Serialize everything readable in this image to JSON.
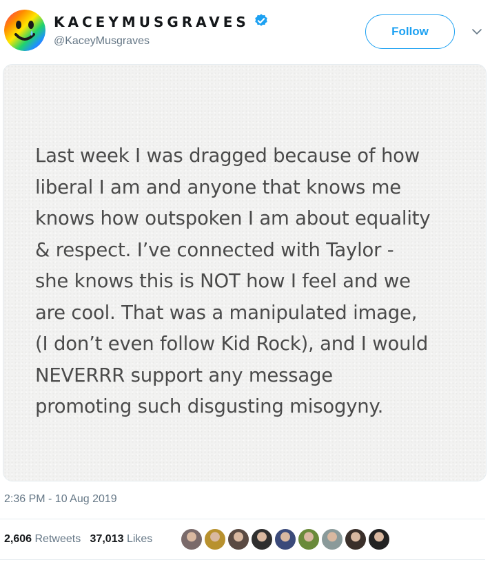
{
  "author": {
    "display_name": "KACEYMUSGRAVES",
    "handle": "@KaceyMusgraves",
    "avatar_icon": "smiley-face-rainbow-avatar",
    "verified_icon": "verified-badge-icon"
  },
  "actions": {
    "follow_label": "Follow",
    "menu_icon": "chevron-down-icon"
  },
  "media": {
    "note_lines": [
      "Last week I was dragged because of how",
      "liberal I am and anyone that knows me",
      "knows how outspoken I am about equality",
      "& respect. I’ve connected with Taylor -",
      "she knows this is NOT how I feel and we",
      "are cool. That was a manipulated image,",
      "(I don’t even follow Kid Rock), and I would",
      "NEVERRR support any message",
      "promoting such disgusting misogyny."
    ]
  },
  "tweet": {
    "timestamp": "2:36 PM - 10 Aug 2019"
  },
  "stats": {
    "retweets_count": "2,606",
    "retweets_label": "Retweets",
    "likes_count": "37,013",
    "likes_label": "Likes"
  },
  "likers": [
    {
      "name": "liker-avatar-1",
      "color": "#7a6a6a"
    },
    {
      "name": "liker-avatar-2",
      "color": "#b8912e"
    },
    {
      "name": "liker-avatar-3",
      "color": "#5a4a42"
    },
    {
      "name": "liker-avatar-4",
      "color": "#2f2f2f"
    },
    {
      "name": "liker-avatar-5",
      "color": "#3b4a7a"
    },
    {
      "name": "liker-avatar-6",
      "color": "#6a8a3a"
    },
    {
      "name": "liker-avatar-7",
      "color": "#8a9a9a"
    },
    {
      "name": "liker-avatar-8",
      "color": "#3a2f2a"
    },
    {
      "name": "liker-avatar-9",
      "color": "#222222"
    }
  ],
  "colors": {
    "accent": "#1da1f2",
    "secondary_text": "#657786",
    "note_text": "#4a4a4a"
  }
}
